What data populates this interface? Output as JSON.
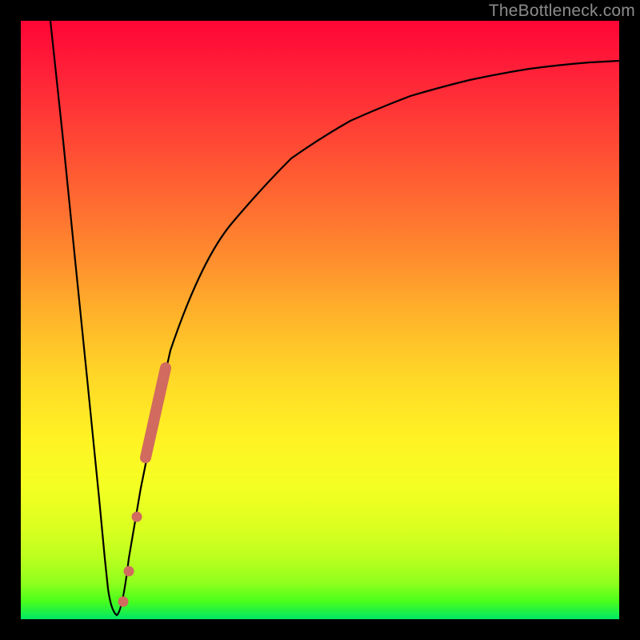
{
  "watermark": "TheBottleneck.com",
  "colors": {
    "curve_stroke": "#000000",
    "marker_stroke": "#d16a5f",
    "marker_fill": "#d16a5f"
  },
  "chart_data": {
    "type": "line",
    "title": "",
    "xlabel": "",
    "ylabel": "",
    "xlim": [
      0,
      100
    ],
    "ylim": [
      0,
      100
    ],
    "grid": false,
    "series": [
      {
        "name": "bottleneck-curve",
        "x": [
          5,
          7,
          9,
          11,
          13,
          14,
          15,
          16,
          17,
          18,
          20,
          22,
          25,
          30,
          35,
          40,
          45,
          50,
          55,
          60,
          65,
          70,
          75,
          80,
          85,
          90,
          95,
          100
        ],
        "y": [
          100,
          80,
          60,
          40,
          20,
          10,
          3,
          0.5,
          3,
          10,
          22,
          32,
          45,
          58,
          66,
          72,
          77,
          80.5,
          83.5,
          85.5,
          87.2,
          88.5,
          89.5,
          90.3,
          91,
          91.5,
          91.9,
          92.2
        ]
      }
    ],
    "markers": [
      {
        "name": "thick-segment",
        "x_start": 20.8,
        "x_end": 24.2,
        "y_start": 27,
        "y_end": 42
      },
      {
        "name": "dot-1",
        "x": 19.4,
        "y": 17
      },
      {
        "name": "dot-2",
        "x": 18.0,
        "y": 8
      },
      {
        "name": "dot-3",
        "x": 17.2,
        "y": 3
      }
    ]
  }
}
